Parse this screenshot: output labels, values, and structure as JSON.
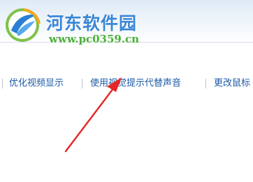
{
  "watermark": {
    "title": "河东软件园",
    "url": "www.pc0359.cn"
  },
  "links": [
    {
      "label": "优化视频显示"
    },
    {
      "label": "使用视觉提示代替声音"
    },
    {
      "label": "更改鼠标"
    }
  ],
  "colors": {
    "link": "#1c5aa6",
    "arrow": "#e52626",
    "watermark_title": "#3a86d6",
    "watermark_url": "#4cae3a"
  },
  "icons": [
    "pc0359-logo-icon",
    "red-arrow-icon"
  ]
}
